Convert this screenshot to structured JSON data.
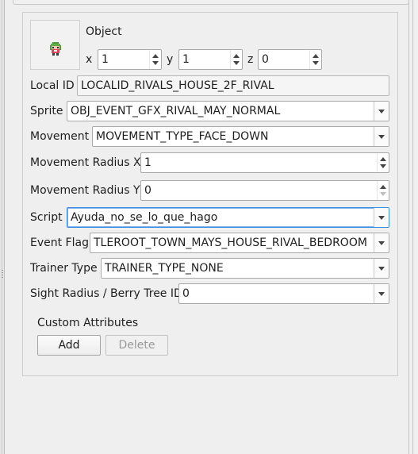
{
  "object_group": {
    "title": "Object",
    "sprite_icon": "rival-may-sprite-icon",
    "coords": {
      "x_label": "x",
      "x_value": "1",
      "y_label": "y",
      "y_value": "1",
      "z_label": "z",
      "z_value": "0"
    }
  },
  "properties": {
    "local_id": {
      "label": "Local ID",
      "value": "LOCALID_RIVALS_HOUSE_2F_RIVAL"
    },
    "sprite": {
      "label": "Sprite",
      "value": "OBJ_EVENT_GFX_RIVAL_MAY_NORMAL"
    },
    "movement": {
      "label": "Movement",
      "value": "MOVEMENT_TYPE_FACE_DOWN"
    },
    "movement_radius_x": {
      "label": "Movement Radius X",
      "value": "1"
    },
    "movement_radius_y": {
      "label": "Movement Radius Y",
      "value": "0"
    },
    "script": {
      "label": "Script",
      "value": "Ayuda_no_se_lo_que_hago"
    },
    "event_flag": {
      "label": "Event Flag",
      "value": "TLEROOT_TOWN_MAYS_HOUSE_RIVAL_BEDROOM"
    },
    "trainer_type": {
      "label": "Trainer Type",
      "value": "TRAINER_TYPE_NONE"
    },
    "sight_radius": {
      "label": "Sight Radius / Berry Tree ID",
      "value": "0"
    }
  },
  "custom_attributes": {
    "title": "Custom Attributes",
    "add_label": "Add",
    "delete_label": "Delete"
  },
  "colors": {
    "window_bg": "#efefef",
    "field_bg": "#ffffff",
    "focus_border": "#3a8ce0",
    "disabled_text": "#9a9a9a"
  }
}
